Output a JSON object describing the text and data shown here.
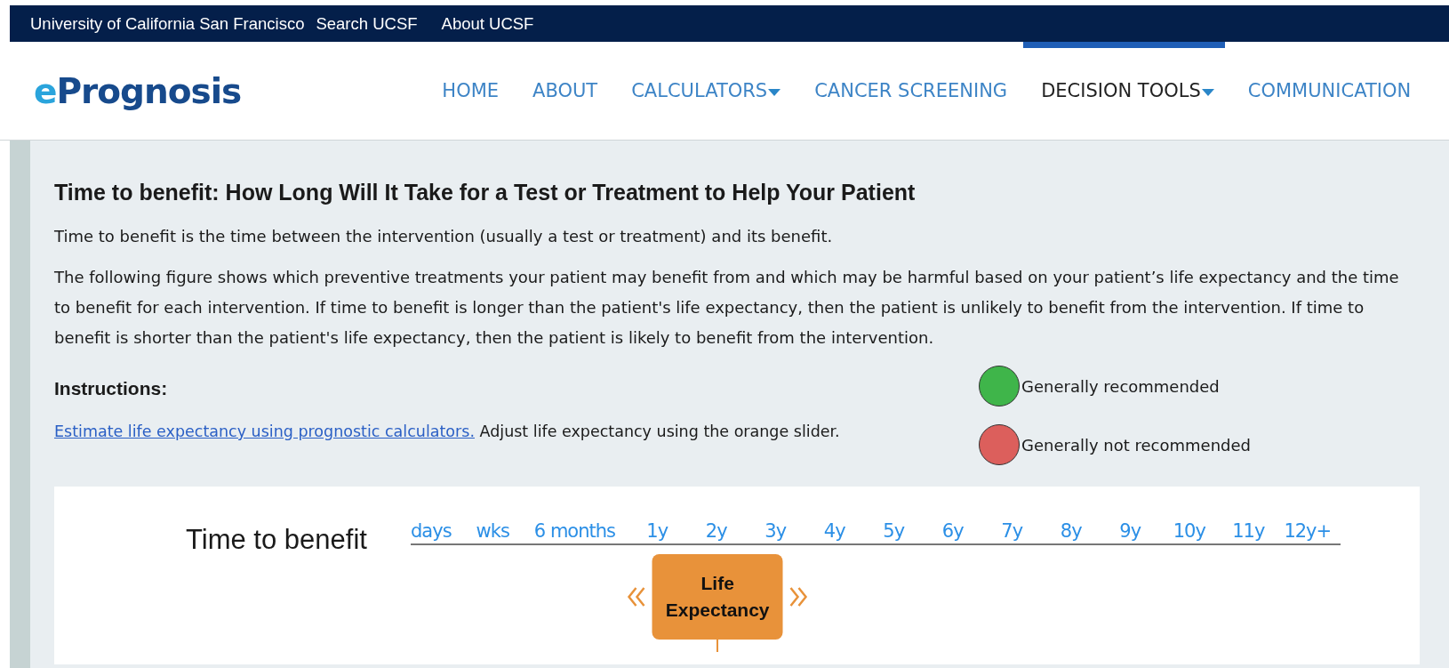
{
  "top_bar": {
    "links": [
      "University of California San Francisco",
      "Search UCSF",
      "About UCSF"
    ]
  },
  "header": {
    "logo": {
      "accent": "e",
      "rest": "Prognosis"
    },
    "nav": [
      {
        "label": "HOME",
        "selected": false,
        "dropdown": false
      },
      {
        "label": "ABOUT",
        "selected": false,
        "dropdown": false
      },
      {
        "label": "CALCULATORS",
        "selected": false,
        "dropdown": true
      },
      {
        "label": "CANCER SCREENING",
        "selected": false,
        "dropdown": false
      },
      {
        "label": "DECISION TOOLS",
        "selected": true,
        "dropdown": true
      },
      {
        "label": "COMMUNICATION",
        "selected": false,
        "dropdown": false
      }
    ]
  },
  "content": {
    "title": "Time to benefit: How Long Will It Take for a Test or Treatment to Help Your Patient",
    "paragraphs": [
      "Time to benefit is the time between the intervention (usually a test or treatment) and its benefit.",
      "The following figure shows which preventive treatments your patient may benefit from and which may be harmful based on your patient’s life expectancy and the time to benefit for each intervention. If time to benefit is longer than the patient's life expectancy, then the patient is unlikely to benefit from the intervention. If time to benefit is shorter than the patient's life expectancy, then the patient is likely to benefit from the intervention."
    ],
    "instructions": {
      "heading": "Instructions:",
      "link": "Estimate life expectancy using prognostic calculators.",
      "text": "Adjust life expectancy using the orange slider."
    },
    "legend": [
      {
        "label": "Generally recommended",
        "color": "#3fb54a"
      },
      {
        "label": "Generally not recommended",
        "color": "#dc5f5c"
      }
    ],
    "figure": {
      "axis_label": "Time to benefit",
      "ticks": [
        "days",
        "wks",
        "6 months",
        "1y",
        "2y",
        "3y",
        "4y",
        "5y",
        "6y",
        "7y",
        "8y",
        "9y",
        "10y",
        "11y",
        "12y+"
      ],
      "slider": {
        "label": "Life Expectancy",
        "level": 0.33
      }
    }
  }
}
